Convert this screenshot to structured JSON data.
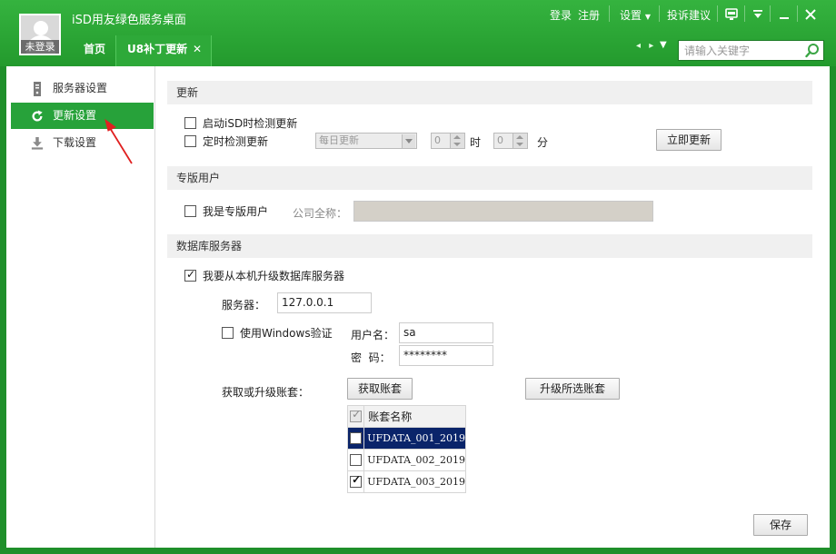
{
  "header": {
    "app_title": "iSD用友绿色服务桌面",
    "avatar_label": "未登录",
    "login": "登录",
    "register": "注册",
    "settings": "设置",
    "feedback": "投诉建议",
    "tabs": [
      {
        "label": "首页"
      },
      {
        "label": "U8补丁更新",
        "close": "✕"
      }
    ],
    "nav_arrows": "◂ ▸",
    "nav_down": "▼",
    "search_placeholder": "请输入关键字",
    "window_buttons": [
      "skin-icon",
      "dropdown-icon",
      "minimize-icon",
      "close-icon"
    ]
  },
  "sidebar": {
    "items": [
      {
        "label": "服务器设置",
        "icon": "server-icon",
        "active": false
      },
      {
        "label": "更新设置",
        "icon": "refresh-icon",
        "active": true
      },
      {
        "label": "下载设置",
        "icon": "download-icon",
        "active": false
      }
    ]
  },
  "update": {
    "header": "更新",
    "check_on_start": "启动iSD时检测更新",
    "check_on_start_checked": false,
    "check_scheduled": "定时检测更新",
    "check_scheduled_checked": false,
    "frequency": "每日更新",
    "hour": "0",
    "hour_unit": "时",
    "minute": "0",
    "minute_unit": "分",
    "update_now": "立即更新"
  },
  "special_user": {
    "header": "专版用户",
    "is_special": "我是专版用户",
    "is_special_checked": false,
    "company_label": "公司全称：",
    "company_value": ""
  },
  "db_server": {
    "header": "数据库服务器",
    "upgrade_from_local": "我要从本机升级数据库服务器",
    "upgrade_from_local_checked": true,
    "server_label": "服务器：",
    "server_value": "127.0.0.1",
    "use_windows_auth": "使用Windows验证",
    "use_windows_auth_checked": false,
    "username_label": "用户名：",
    "username_value": "sa",
    "password_label": "密  码：",
    "password_value": "********",
    "accounts_label": "获取或升级账套：",
    "get_accounts": "获取账套",
    "upgrade_selected": "升级所选账套",
    "table_header": "账套名称",
    "accounts": [
      {
        "name": "UFDATA_001_2019",
        "checked": false,
        "selected": true
      },
      {
        "name": "UFDATA_002_2019",
        "checked": false,
        "selected": false
      },
      {
        "name": "UFDATA_003_2019",
        "checked": true,
        "selected": false
      }
    ]
  },
  "footer": {
    "save": "保存"
  },
  "colors": {
    "brand_green": "#27a23a",
    "selection_blue": "#0a246a",
    "annotation_red": "#e02020"
  }
}
